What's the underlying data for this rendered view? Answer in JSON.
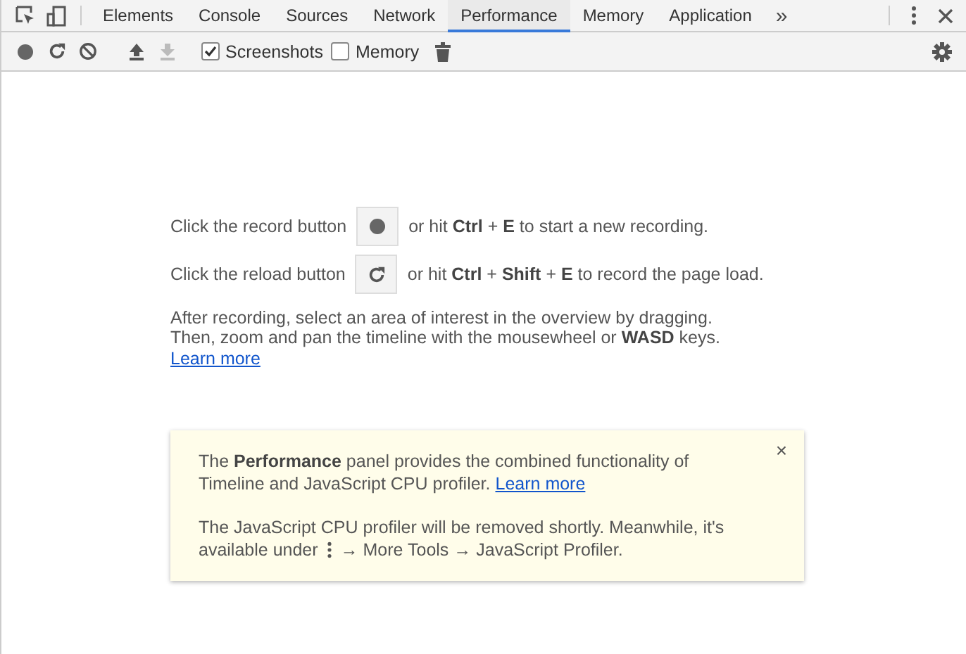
{
  "tabs": [
    {
      "label": "Elements",
      "selected": false
    },
    {
      "label": "Console",
      "selected": false
    },
    {
      "label": "Sources",
      "selected": false
    },
    {
      "label": "Network",
      "selected": false
    },
    {
      "label": "Performance",
      "selected": true
    },
    {
      "label": "Memory",
      "selected": false
    },
    {
      "label": "Application",
      "selected": false
    }
  ],
  "more_tabs": "»",
  "toolbar": {
    "checkboxes": [
      {
        "label": "Screenshots",
        "checked": true
      },
      {
        "label": "Memory",
        "checked": false
      }
    ]
  },
  "hints": [
    {
      "kind": "record",
      "before": "Click the record button",
      "after": "or hit **Ctrl** + **E** to start a new recording."
    },
    {
      "kind": "reload",
      "before": "Click the reload button",
      "after": "or hit **Ctrl** + **Shift** + **E** to record the page load."
    }
  ],
  "help": {
    "text": "After recording, select an area of interest in the overview by dragging. Then, zoom and pan the timeline with the mousewheel or **WASD** keys.",
    "link": "Learn more"
  },
  "notice": {
    "close": "×",
    "intro": "The **Performance** panel provides the combined functionality of Timeline and JavaScript CPU profiler.",
    "link": "Learn more",
    "removal_line": "The JavaScript CPU profiler will be removed shortly. Meanwhile, it's",
    "before_icon": "available under",
    "after_icon": "→ More Tools → JavaScript Profiler."
  }
}
